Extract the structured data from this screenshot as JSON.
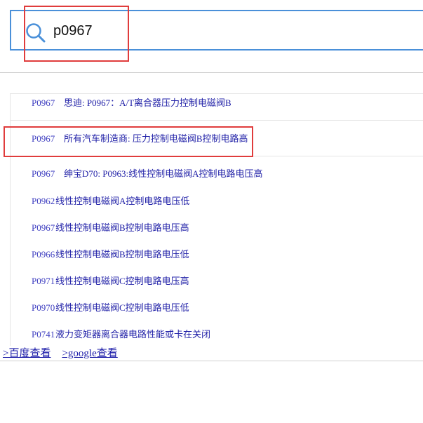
{
  "search": {
    "value": "p0967",
    "icon": "search-icon",
    "border_color": "#4a90d9"
  },
  "highlight_color": "#e03c3c",
  "results": [
    {
      "code": "P0967",
      "desc": "思迪: P0967：A/T离合器压力控制电磁阀B"
    },
    {
      "code": "P0967",
      "desc": "所有汽车制造商: 压力控制电磁阀B控制电路高"
    },
    {
      "code": "P0967",
      "desc": "绅宝D70: P0963:线性控制电磁阀A控制电路电压高"
    },
    {
      "code": "P0962",
      "desc": "线性控制电磁阀A控制电路电压低"
    },
    {
      "code": "P0967",
      "desc": "线性控制电磁阀B控制电路电压高"
    },
    {
      "code": "P0966",
      "desc": "线性控制电磁阀B控制电路电压低"
    },
    {
      "code": "P0971",
      "desc": "线性控制电磁阀C控制电路电压高"
    },
    {
      "code": "P0970",
      "desc": "线性控制电磁阀C控制电路电压低"
    },
    {
      "code": "P0741",
      "desc": "液力变矩器离合器电路性能或卡在关闭"
    }
  ],
  "links": {
    "baidu": ">百度查看",
    "google": ">google查看"
  }
}
